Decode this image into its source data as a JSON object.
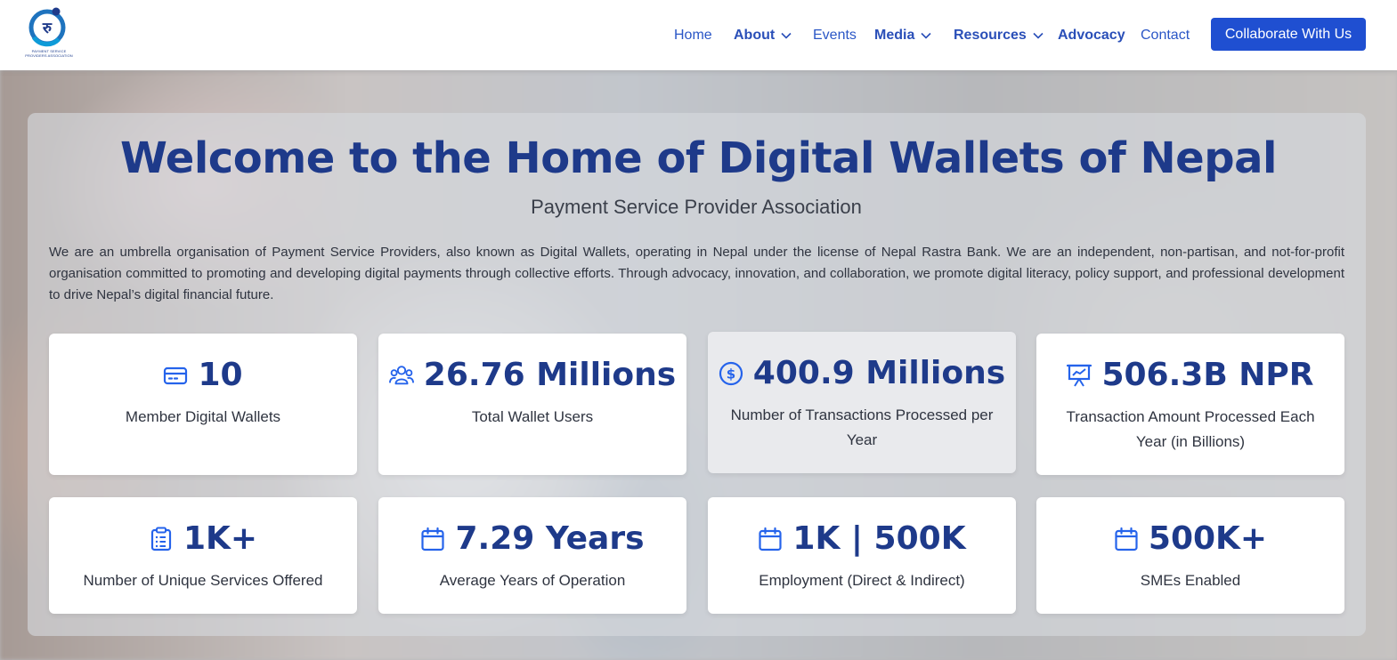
{
  "brand": {
    "logo_text": "PAYMENT SERVICE PROVIDERS ASSOCIATION",
    "logo_glyph": "रु",
    "accent": "#1f4fd1",
    "navy": "#1e3a8a"
  },
  "nav": {
    "items": [
      {
        "label": "Home",
        "has_dropdown": false
      },
      {
        "label": "About",
        "has_dropdown": true
      },
      {
        "label": "Events",
        "has_dropdown": false
      },
      {
        "label": "Media",
        "has_dropdown": true
      },
      {
        "label": "Resources",
        "has_dropdown": true
      },
      {
        "label": "Advocacy",
        "has_dropdown": false
      },
      {
        "label": "Contact",
        "has_dropdown": false
      }
    ],
    "cta_label": "Collaborate With Us"
  },
  "hero": {
    "title": "Welcome to the Home of Digital Wallets of Nepal",
    "subtitle": "Payment Service Provider Association",
    "description": "We are an umbrella organisation of Payment Service Providers, also known as Digital Wallets, operating in Nepal under the license of Nepal Rastra Bank. We are an independent, non-partisan, and not-for-profit organisation committed to promoting and developing digital payments through collective efforts. Through advocacy, innovation, and collaboration, we promote digital literacy, policy support, and professional development to drive Nepal’s digital financial future."
  },
  "stats": [
    {
      "icon": "wallet-card-icon",
      "value": "10",
      "label": "Member Digital Wallets"
    },
    {
      "icon": "users-icon",
      "value": "26.76 Millions",
      "label": "Total Wallet Users"
    },
    {
      "icon": "dollar-circle-icon",
      "value": "400.9 Millions",
      "label": "Number of Transactions Processed per Year"
    },
    {
      "icon": "chart-presentation-icon",
      "value": "506.3B NPR",
      "label": "Transaction Amount Processed Each Year (in Billions)"
    },
    {
      "icon": "clipboard-list-icon",
      "value": "1K+",
      "label": "Number of Unique Services Offered"
    },
    {
      "icon": "calendar-icon",
      "value": "7.29 Years",
      "label": "Average Years of Operation"
    },
    {
      "icon": "calendar-icon",
      "value": "1K | 500K",
      "label": "Employment (Direct & Indirect)"
    },
    {
      "icon": "calendar-icon",
      "value": "500K+",
      "label": "SMEs Enabled"
    }
  ]
}
